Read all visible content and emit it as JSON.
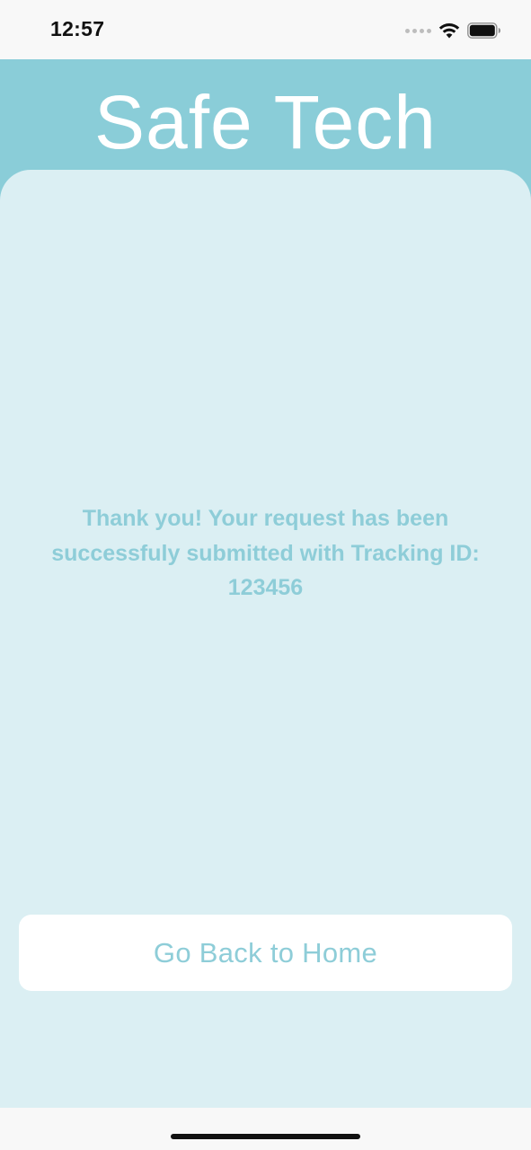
{
  "status_bar": {
    "time": "12:57",
    "icons": [
      "signal-dots-icon",
      "wifi-icon",
      "battery-icon"
    ]
  },
  "header": {
    "title": "Safe Tech",
    "background_color": "#8acdd8"
  },
  "main": {
    "message": "Thank you! Your request has been successfuly submitted with Tracking ID: 123456",
    "panel_color": "#dbeff3",
    "text_color": "#8ecdd8"
  },
  "actions": {
    "home_button_label": "Go Back to Home"
  }
}
